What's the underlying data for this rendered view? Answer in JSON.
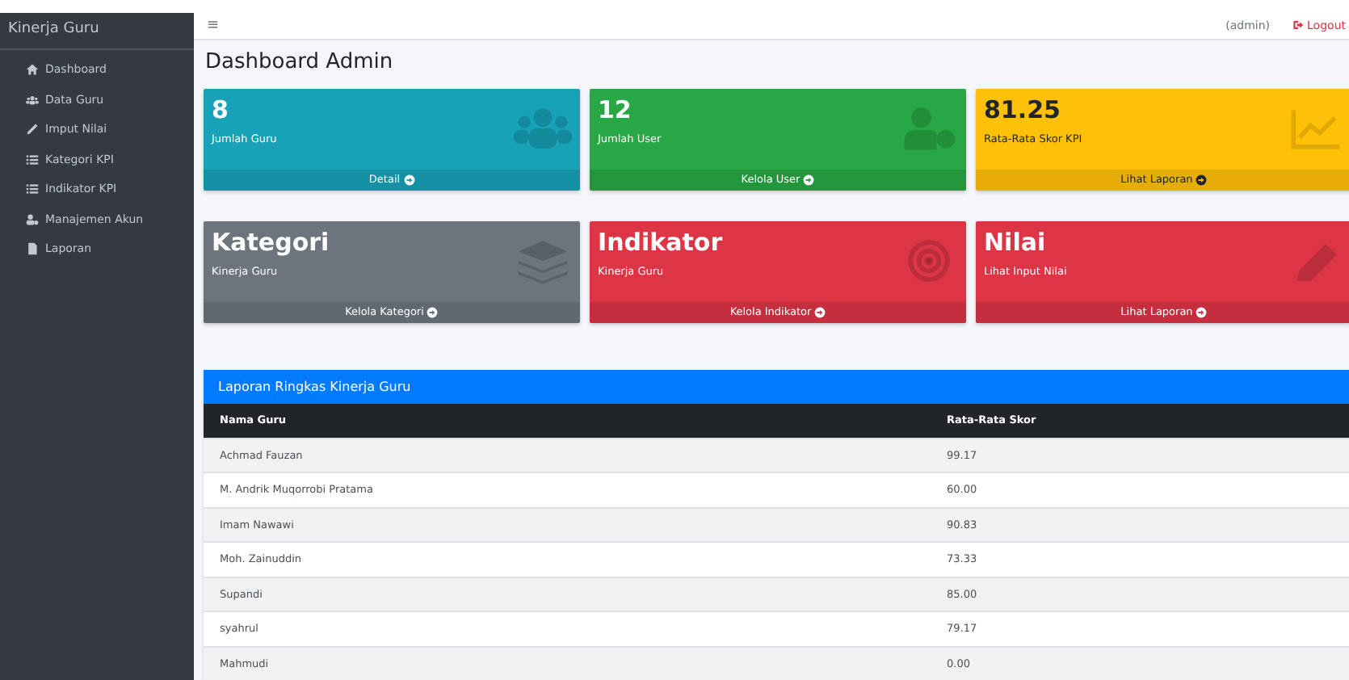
{
  "sidebar": {
    "brand": "Kinerja Guru",
    "items": [
      {
        "label": "Dashboard",
        "selected": false
      },
      {
        "label": "Data Guru",
        "selected": false
      },
      {
        "label": "Imput Nilai",
        "selected": false
      },
      {
        "label": "Kategori KPI",
        "selected": false
      },
      {
        "label": "Indikator KPI",
        "selected": false
      },
      {
        "label": "Manajemen Akun",
        "selected": false
      },
      {
        "label": "Laporan",
        "selected": false
      }
    ]
  },
  "topbar": {
    "menu": "≡",
    "user": "(admin)",
    "logout": "Logout"
  },
  "page_title": "Dashboard Admin",
  "cards": [
    {
      "value": "8",
      "label": "Jumlah Guru",
      "link": "Detail",
      "color": "#17a2b8"
    },
    {
      "value": "12",
      "label": "Jumlah User",
      "link": "Kelola User",
      "color": "#28a745"
    },
    {
      "value": "81.25",
      "label": "Rata-Rata Skor KPI",
      "link": "Lihat Laporan",
      "color": "#ffc107"
    },
    {
      "value": "Kategori",
      "label": "Kinerja Guru",
      "link": "Kelola Kategori",
      "color": "#6c757d"
    },
    {
      "value": "Indikator",
      "label": "Kinerja Guru",
      "link": "Kelola Indikator",
      "color": "#dc3545"
    },
    {
      "value": "Nilai",
      "label": "Lihat Input Nilai",
      "link": "Lihat Laporan",
      "color": "#dc3545"
    }
  ],
  "report": {
    "title": "Laporan Ringkas Kinerja Guru",
    "columns": [
      "Nama Guru",
      "Rata-Rata Skor"
    ],
    "rows": [
      [
        "Achmad Fauzan",
        "99.17"
      ],
      [
        "M. Andrik Muqorrobi Pratama",
        "60.00"
      ],
      [
        "Imam Nawawi",
        "90.83"
      ],
      [
        "Moh. Zainuddin",
        "73.33"
      ],
      [
        "Supandi",
        "85.00"
      ],
      [
        "syahrul",
        "79.17"
      ],
      [
        "Mahmudi",
        "0.00"
      ]
    ]
  }
}
